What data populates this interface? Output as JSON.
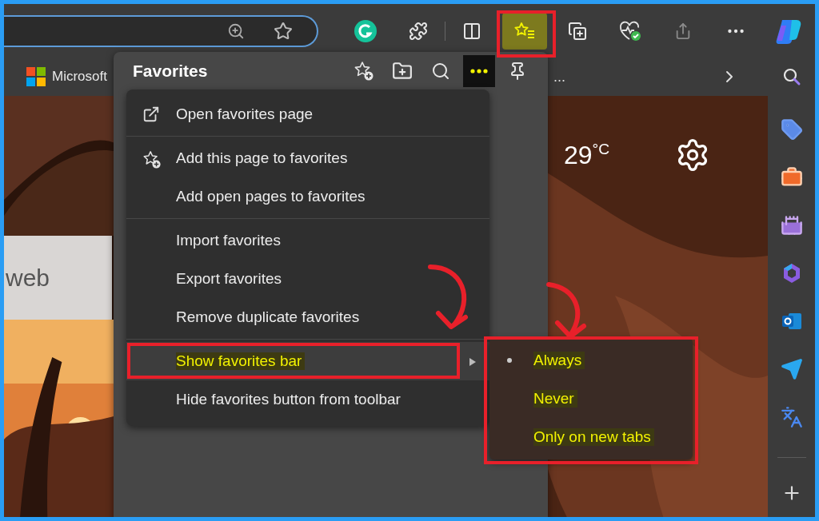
{
  "toolbar": {
    "favorites_selected": true
  },
  "bookmarks_bar": {
    "items": [
      {
        "label": "Microsoft"
      }
    ],
    "overflow": "..."
  },
  "page": {
    "card_text": "web",
    "temperature": "29$^{°C}$"
  },
  "favorites": {
    "title": "Favorites",
    "more_selected": true,
    "groups": [
      [
        {
          "kind": "external",
          "label": "Open favorites page",
          "highlighted": false
        }
      ],
      [
        {
          "kind": "star",
          "label": "Add this page to favorites",
          "highlighted": false
        },
        {
          "kind": "plain",
          "label": "Add open pages to favorites",
          "highlighted": false
        }
      ],
      [
        {
          "kind": "plain",
          "label": "Import favorites",
          "highlighted": false
        },
        {
          "kind": "plain",
          "label": "Export favorites",
          "highlighted": false
        },
        {
          "kind": "plain",
          "label": "Remove duplicate favorites",
          "highlighted": false
        }
      ],
      [
        {
          "kind": "submenu",
          "label": "Show favorites bar",
          "highlighted": true,
          "expanded": true
        },
        {
          "kind": "plain",
          "label": "Hide favorites button from toolbar",
          "highlighted": false
        }
      ]
    ],
    "submenu": [
      {
        "label": "Always",
        "selected": true,
        "highlighted": true
      },
      {
        "label": "Never",
        "selected": false,
        "highlighted": true
      },
      {
        "label": "Only on new tabs",
        "selected": false,
        "highlighted": true
      }
    ]
  }
}
